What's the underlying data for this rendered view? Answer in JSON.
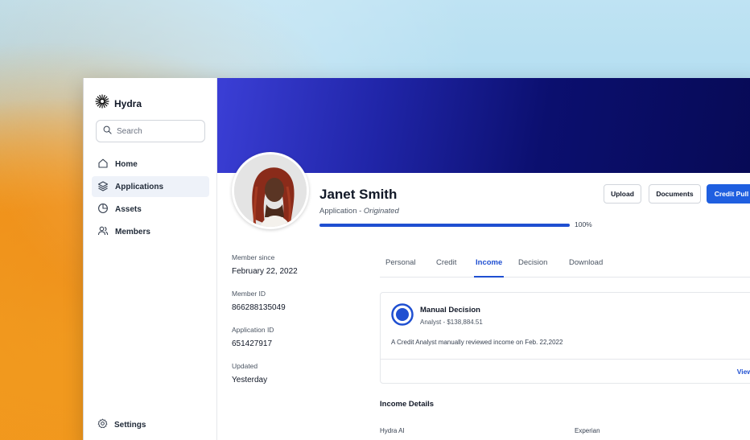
{
  "sidebar": {
    "brand": "Hydra",
    "search_placeholder": "Search",
    "items": [
      {
        "label": "Home",
        "icon": "home-icon"
      },
      {
        "label": "Applications",
        "icon": "layers-icon"
      },
      {
        "label": "Assets",
        "icon": "pie-chart-icon"
      },
      {
        "label": "Members",
        "icon": "users-icon"
      }
    ],
    "settings_label": "Settings"
  },
  "profile": {
    "name": "Janet Smith",
    "subtitle_prefix": "Application - ",
    "status": "Originated",
    "progress": 100,
    "progress_label": "100%"
  },
  "actions": {
    "upload": "Upload",
    "documents": "Documents",
    "credit_pull": "Credit Pull"
  },
  "info": [
    {
      "label": "Member since",
      "value": "February 22, 2022"
    },
    {
      "label": "Member ID",
      "value": "866288135049"
    },
    {
      "label": "Application ID",
      "value": "651427917"
    },
    {
      "label": "Updated",
      "value": "Yesterday"
    }
  ],
  "tabs": [
    "Personal",
    "Credit",
    "Income",
    "Decision",
    "Download"
  ],
  "active_tab": "Income",
  "decision_card": {
    "title": "Manual Decision",
    "subtitle": "Analyst - $138,884.51",
    "description": "A Credit Analyst manually reviewed income on Feb. 22,2022",
    "view_label": "View"
  },
  "income_details": {
    "title": "Income Details",
    "columns": [
      "Hydra AI",
      "Experian"
    ]
  },
  "colors": {
    "accent": "#1f4fd1",
    "primary_button": "#1f5fe0",
    "banner_dark": "#070a55",
    "banner_light": "#3b3fd6"
  }
}
